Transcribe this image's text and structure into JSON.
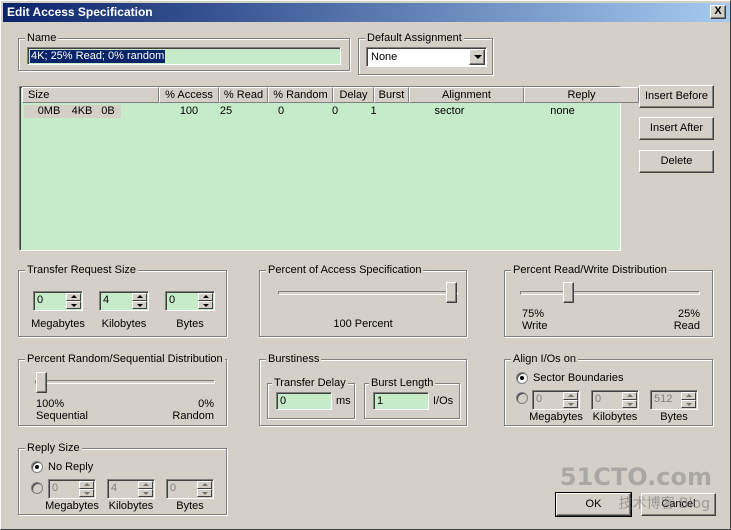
{
  "window": {
    "title": "Edit Access Specification",
    "close": "X"
  },
  "name_group": {
    "title": "Name",
    "value": "4K; 25% Read; 0% random"
  },
  "default_assignment": {
    "title": "Default Assignment",
    "selected": "None"
  },
  "table": {
    "headers": [
      "Size",
      "% Access",
      "% Read",
      "% Random",
      "Delay",
      "Burst",
      "Alignment",
      "Reply"
    ],
    "rows": [
      {
        "size_mb": "0MB",
        "size_kb": "4KB",
        "size_b": "0B",
        "access": "100",
        "read": "25",
        "random": "0",
        "delay": "0",
        "burst": "1",
        "alignment": "sector",
        "reply": "none"
      }
    ]
  },
  "buttons": {
    "insert_before": "Insert Before",
    "insert_after": "Insert After",
    "delete": "Delete",
    "ok": "OK",
    "cancel": "Cancel"
  },
  "transfer_size": {
    "title": "Transfer Request Size",
    "megabytes": "0",
    "kilobytes": "4",
    "bytes": "0",
    "labels": {
      "megabytes": "Megabytes",
      "kilobytes": "Kilobytes",
      "bytes": "Bytes"
    }
  },
  "percent_access": {
    "title": "Percent of Access Specification",
    "value_label": "100 Percent",
    "value": 100
  },
  "read_write": {
    "title": "Percent Read/Write Distribution",
    "write_pct": "75%",
    "write_label": "Write",
    "read_pct": "25%",
    "read_label": "Read",
    "value": 25
  },
  "random_seq": {
    "title": "Percent Random/Sequential Distribution",
    "seq_pct": "100%",
    "seq_label": "Sequential",
    "rand_pct": "0%",
    "rand_label": "Random",
    "value": 0
  },
  "burstiness": {
    "title": "Burstiness",
    "transfer_delay": {
      "title": "Transfer Delay",
      "value": "0",
      "unit": "ms"
    },
    "burst_length": {
      "title": "Burst Length",
      "value": "1",
      "unit": "I/Os"
    }
  },
  "align": {
    "title": "Align I/Os on",
    "sector_label": "Sector Boundaries",
    "megabytes": "0",
    "kilobytes": "0",
    "bytes": "512",
    "labels": {
      "megabytes": "Megabytes",
      "kilobytes": "Kilobytes",
      "bytes": "Bytes"
    }
  },
  "reply": {
    "title": "Reply Size",
    "no_reply_label": "No Reply",
    "megabytes": "0",
    "kilobytes": "4",
    "bytes": "0",
    "labels": {
      "megabytes": "Megabytes",
      "kilobytes": "Kilobytes",
      "bytes": "Bytes"
    }
  },
  "watermark": {
    "main": "51CTO.com",
    "sub": "技术博客 Blog"
  },
  "colors": {
    "field": "#c6ebc9",
    "titlebar": "#0a246a",
    "face": "#d4d0c8"
  }
}
